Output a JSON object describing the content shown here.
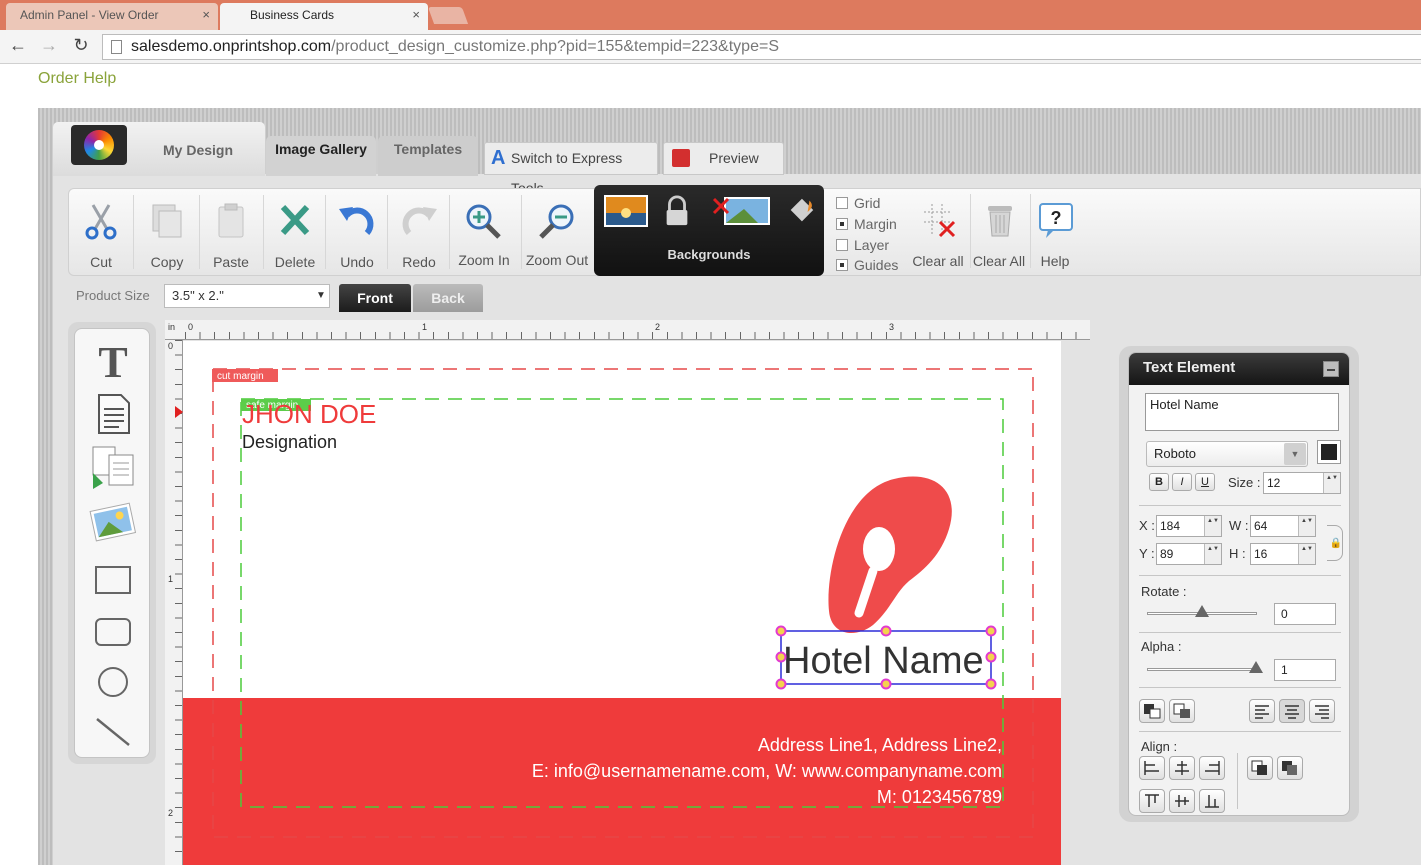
{
  "browser": {
    "tabs": [
      {
        "label": "Admin Panel - View Order",
        "active": false
      },
      {
        "label": "Business Cards",
        "active": true
      }
    ],
    "url_host": "salesdemo.onprintshop.com",
    "url_path": "/product_design_customize.php?pid=155&tempid=223&type=S",
    "close_glyph": "×"
  },
  "page": {
    "order_help": "Order Help"
  },
  "app_tabs": {
    "my_design": "My Design",
    "image_gallery": "Image Gallery",
    "templates": "Templates",
    "express_tools": "Switch to Express Tools",
    "preview": "Preview"
  },
  "toolbar": {
    "cut": "Cut",
    "copy": "Copy",
    "paste": "Paste",
    "delete": "Delete",
    "undo": "Undo",
    "redo": "Redo",
    "zoom_in": "Zoom In",
    "zoom_out": "Zoom Out",
    "backgrounds": "Backgrounds",
    "grid": "Grid",
    "margin": "Margin",
    "layer": "Layer",
    "guides": "Guides",
    "clear_all_1": "Clear all",
    "clear_all_2": "Clear All",
    "help": "Help"
  },
  "product": {
    "size_label": "Product Size",
    "size_value": "3.5\" x 2.\"",
    "front": "Front",
    "back": "Back"
  },
  "ruler": {
    "unit": "in",
    "top_labels": [
      "0",
      "1",
      "2",
      "3"
    ],
    "left_labels": [
      "0",
      "1",
      "2"
    ]
  },
  "card": {
    "cut_margin": "cut margin",
    "safe_margin": "safe margin",
    "name": "JHON DOE",
    "designation": "Designation",
    "hotel_name": "Hotel Name",
    "address": "Address Line1, Address Line2,",
    "email_web": "E: info@usernamename.com, W: www.companyname.com",
    "mobile": "M: 0123456789",
    "colors": {
      "accent": "#ef3b3b",
      "cut_margin": "#e54848",
      "safe_margin": "#4ccb3a",
      "selection": "#2b2bd8",
      "handle": "#e23ad0"
    }
  },
  "text_element": {
    "title": "Text Element",
    "text_value": "Hotel Name",
    "font": "Roboto",
    "bold": "B",
    "italic": "I",
    "underline": "U",
    "size_label": "Size :",
    "size_value": "12",
    "x_label": "X :",
    "x_value": "184",
    "y_label": "Y :",
    "y_value": "89",
    "w_label": "W :",
    "w_value": "64",
    "h_label": "H :",
    "h_value": "16",
    "rotate_label": "Rotate :",
    "rotate_value": "0",
    "alpha_label": "Alpha :",
    "alpha_value": "1",
    "align_label": "Align :"
  }
}
